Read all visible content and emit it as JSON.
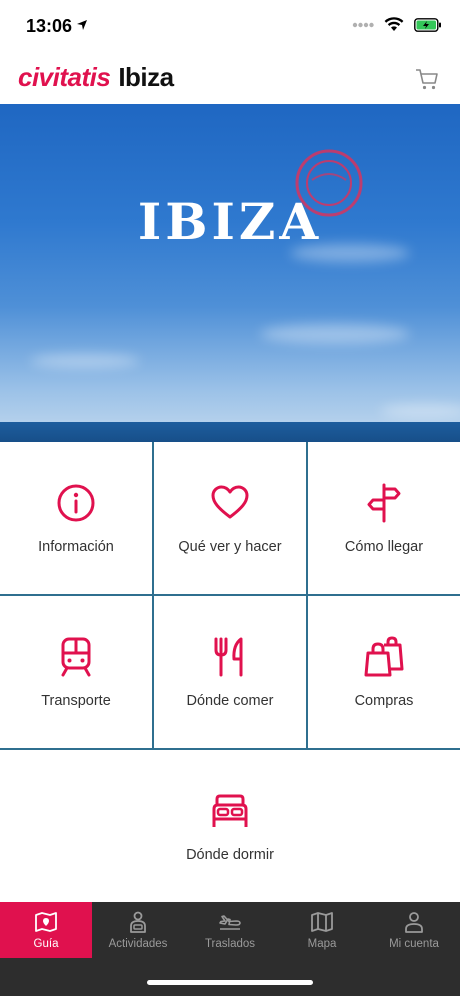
{
  "status": {
    "time": "13:06"
  },
  "header": {
    "brand": "civitatis",
    "city": "Ibiza"
  },
  "hero": {
    "title": "IBIZA"
  },
  "grid": {
    "items": [
      {
        "label": "Información",
        "icon": "info-icon"
      },
      {
        "label": "Qué ver y hacer",
        "icon": "heart-icon"
      },
      {
        "label": "Cómo llegar",
        "icon": "signpost-icon"
      },
      {
        "label": "Transporte",
        "icon": "train-icon"
      },
      {
        "label": "Dónde comer",
        "icon": "fork-knife-icon"
      },
      {
        "label": "Compras",
        "icon": "shopping-bags-icon"
      },
      {
        "label": "Dónde dormir",
        "icon": "bed-icon"
      }
    ]
  },
  "tabbar": {
    "items": [
      {
        "label": "Guía",
        "icon": "map-guide-icon",
        "active": true
      },
      {
        "label": "Actividades",
        "icon": "person-ticket-icon",
        "active": false
      },
      {
        "label": "Traslados",
        "icon": "plane-icon",
        "active": false
      },
      {
        "label": "Mapa",
        "icon": "map-icon",
        "active": false
      },
      {
        "label": "Mi cuenta",
        "icon": "user-icon",
        "active": false
      }
    ]
  },
  "colors": {
    "accent": "#e0114e",
    "tabbar": "#2d2d2d",
    "grid_line": "#2f6f8f"
  }
}
